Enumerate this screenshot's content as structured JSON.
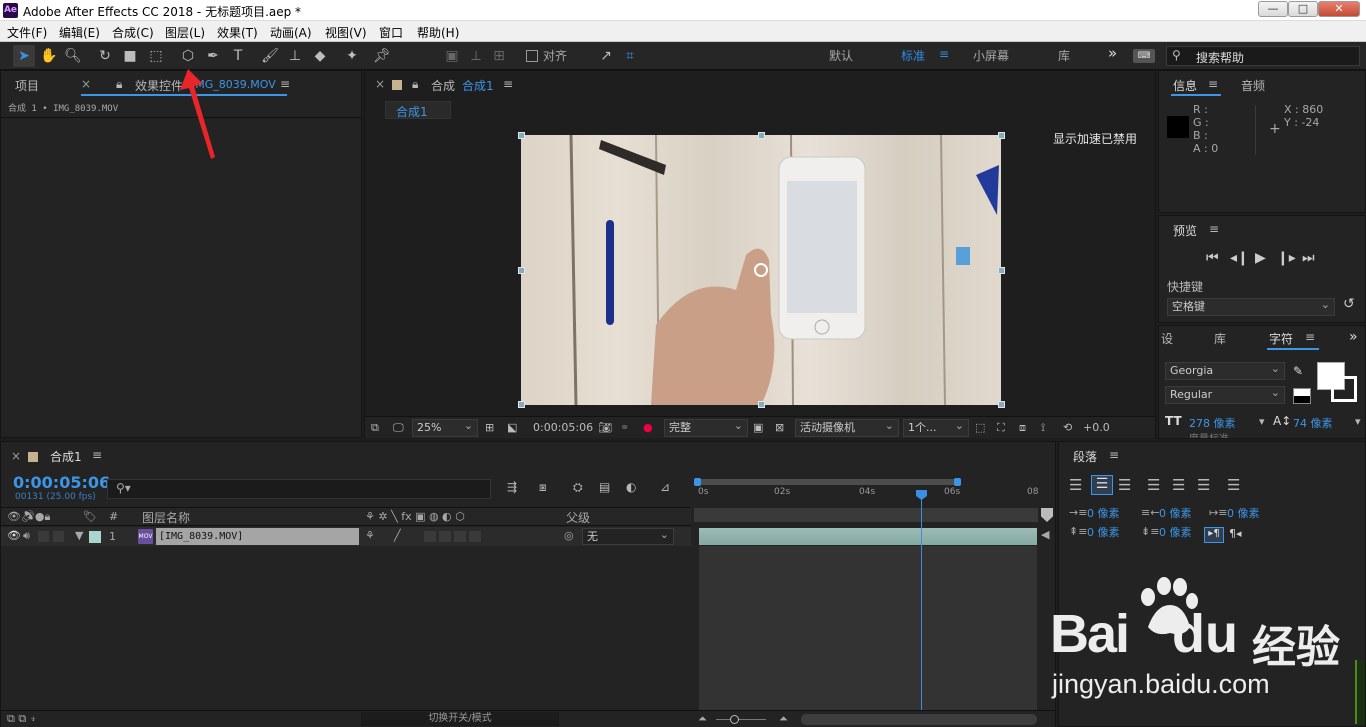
{
  "window": {
    "app_icon": "Ae",
    "title": "Adobe After Effects CC 2018 - 无标题项目.aep *",
    "min": "—",
    "max": "□",
    "close": "✕"
  },
  "menu": [
    "文件(F)",
    "编辑(E)",
    "合成(C)",
    "图层(L)",
    "效果(T)",
    "动画(A)",
    "视图(V)",
    "窗口",
    "帮助(H)"
  ],
  "toolbar": {
    "snap_label": "对齐",
    "workspaces": [
      "默认",
      "标准",
      "小屏幕",
      "库"
    ],
    "active_workspace": "标准",
    "more": "»",
    "search_placeholder": "搜索帮助"
  },
  "project_panel": {
    "tab_project": "项目",
    "tab_effects": "效果控件",
    "effects_target": "IMG_8039.MOV",
    "menu": "≡",
    "breadcrumb": "合成 1 • IMG_8039.MOV"
  },
  "composition_panel": {
    "tab_prefix": "合成",
    "tab_name": "合成1",
    "menu": "≡",
    "subtab": "合成1",
    "gpu_notice": "显示加速已禁用"
  },
  "viewer_controls": {
    "zoom": "25%",
    "timecode": "0:00:05:06",
    "resolution": "完整",
    "camera": "活动摄像机",
    "views": "1个...",
    "exposure": "+0.0"
  },
  "info_panel": {
    "tab_info": "信息",
    "tab_audio": "音频",
    "r": "R :",
    "g": "G :",
    "b": "B :",
    "a": "A : 0",
    "x": "X : 860",
    "y": "Y : -24"
  },
  "preview_panel": {
    "title": "预览",
    "shortcut_label": "快捷键",
    "shortcut_value": "空格键"
  },
  "character_panel": {
    "tab_settings": "设",
    "tab_library": "库",
    "tab_character": "字符",
    "font": "Georgia",
    "style": "Regular",
    "size": "278 像素",
    "leading": "74 像素",
    "tracking_hint": "度量标准"
  },
  "paragraph_panel": {
    "title": "段落",
    "indent_left": "0 像素",
    "indent_right": "0 像素",
    "indent_first": "0 像素",
    "space_before": "0 像素",
    "space_after": "0 像素"
  },
  "timeline": {
    "tab": "合成1",
    "timecode": "0:00:05:06",
    "frames": "00131 (25.00 fps)",
    "columns": {
      "num": "#",
      "layer_name": "图层名称",
      "parent": "父级"
    },
    "layer": {
      "num": "1",
      "name": "[IMG_8039.MOV]",
      "parent": "无"
    },
    "ticks": [
      "0s",
      "02s",
      "04s",
      "06s",
      "08"
    ],
    "footer": "切换开关/模式",
    "playhead_fraction": 0.667
  },
  "colors": {
    "accent": "#2f8de4",
    "layer_bar": "#8fb7b0",
    "label": "#a9d4d0"
  },
  "watermark": {
    "brand_left": "Bai",
    "brand_right": "du",
    "brand_cn": "经验",
    "url": "jingyan.baidu.com"
  }
}
